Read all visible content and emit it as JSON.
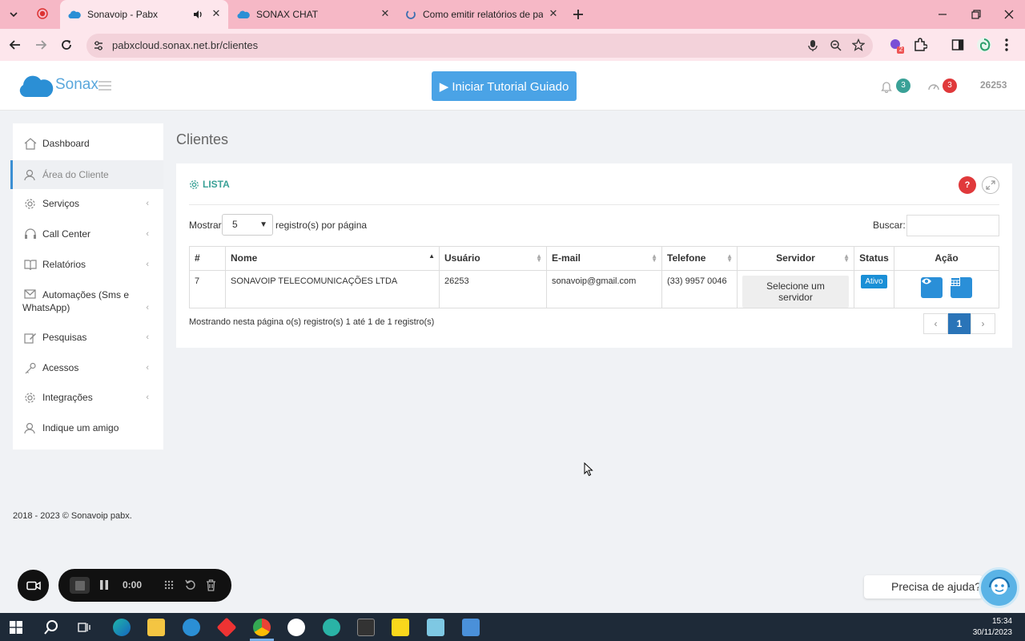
{
  "browser": {
    "tabs": [
      {
        "title": "Sonavoip - Pabx",
        "active": true
      },
      {
        "title": "SONAX CHAT",
        "active": false
      },
      {
        "title": "Como emitir relatórios de pau",
        "active": false
      }
    ],
    "url": "pabxcloud.sonax.net.br/clientes",
    "extension_badge": "2"
  },
  "header": {
    "brand": "Sonax",
    "tutorial_button": "▶ Iniciar Tutorial Guiado",
    "notifications_count": "3",
    "alerts_count": "3",
    "user_extension": "26253",
    "colors": {
      "tutorial": "#4aa3e6",
      "notif_badge": "#3aa197",
      "alert_badge": "#e0393b"
    }
  },
  "sidebar": {
    "items": [
      {
        "label": "Dashboard",
        "icon": "home-icon",
        "submenu": false
      },
      {
        "label": "Área do Cliente",
        "icon": "user-icon",
        "submenu": false,
        "active": true
      },
      {
        "label": "Serviços",
        "icon": "gear-icon",
        "submenu": true
      },
      {
        "label": "Call Center",
        "icon": "headset-icon",
        "submenu": true
      },
      {
        "label": "Relatórios",
        "icon": "book-icon",
        "submenu": true
      },
      {
        "label": "Automações (Sms e WhatsApp)",
        "icon": "envelope-icon",
        "submenu": true
      },
      {
        "label": "Pesquisas",
        "icon": "pencil-icon",
        "submenu": true
      },
      {
        "label": "Acessos",
        "icon": "key-icon",
        "submenu": true
      },
      {
        "label": "Integrações",
        "icon": "gear-icon",
        "submenu": true
      },
      {
        "label": "Indique um amigo",
        "icon": "user-icon",
        "submenu": false
      }
    ]
  },
  "main": {
    "page_title": "Clientes",
    "card_title": "LISTA",
    "help_label": "?",
    "show_label": "Mostrar",
    "page_size": "5",
    "per_page_label": "registro(s) por página",
    "search_label": "Buscar:",
    "search_value": "",
    "table": {
      "columns": [
        "#",
        "Nome",
        "Usuário",
        "E-mail",
        "Telefone",
        "Servidor",
        "Status",
        "Ação"
      ],
      "rows": [
        {
          "id": "7",
          "name": "SONAVOIP TELECOMUNICAÇÕES LTDA",
          "user": "26253",
          "email": "sonavoip@gmail.com",
          "phone": "(33) 9957 0046",
          "server": "Selecione um servidor",
          "status": "Ativo"
        }
      ]
    },
    "info": "Mostrando nesta página o(s) registro(s) 1 até 1 de 1 registro(s)",
    "pagination": {
      "prev": "‹",
      "current": "1",
      "next": "›"
    }
  },
  "footer": {
    "text": "2018 - 2023 © Sonavoip pabx."
  },
  "recorder": {
    "time": "0:00"
  },
  "help_chat": {
    "label": "Precisa de ajuda?"
  },
  "taskbar": {
    "time": "15:34",
    "date": "30/11/2023"
  }
}
